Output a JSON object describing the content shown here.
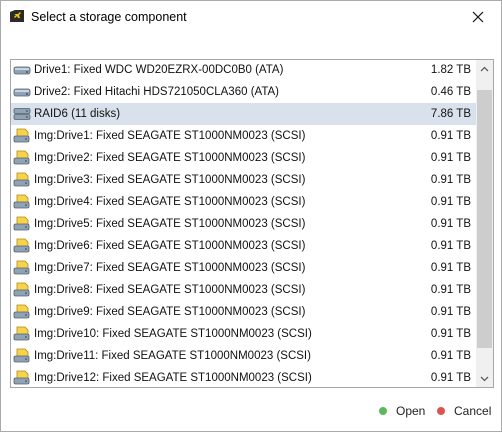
{
  "window": {
    "title": "Select a storage component"
  },
  "list": {
    "rows": [
      {
        "name": "Drive1: Fixed WDC WD20EZRX-00DC0B0 (ATA)",
        "size": "1.82 TB",
        "icon": "hard-drive-icon",
        "selected": false
      },
      {
        "name": "Drive2: Fixed Hitachi HDS721050CLA360 (ATA)",
        "size": "0.46 TB",
        "icon": "hard-drive-icon",
        "selected": false
      },
      {
        "name": "RAID6 (11 disks)",
        "size": "7.86 TB",
        "icon": "raid-icon",
        "selected": true
      },
      {
        "name": "Img:Drive1: Fixed SEAGATE ST1000NM0023 (SCSI)",
        "size": "0.91 TB",
        "icon": "image-drive-icon",
        "selected": false
      },
      {
        "name": "Img:Drive2: Fixed SEAGATE ST1000NM0023 (SCSI)",
        "size": "0.91 TB",
        "icon": "image-drive-icon",
        "selected": false
      },
      {
        "name": "Img:Drive3: Fixed SEAGATE ST1000NM0023 (SCSI)",
        "size": "0.91 TB",
        "icon": "image-drive-icon",
        "selected": false
      },
      {
        "name": "Img:Drive4: Fixed SEAGATE ST1000NM0023 (SCSI)",
        "size": "0.91 TB",
        "icon": "image-drive-icon",
        "selected": false
      },
      {
        "name": "Img:Drive5: Fixed SEAGATE ST1000NM0023 (SCSI)",
        "size": "0.91 TB",
        "icon": "image-drive-icon",
        "selected": false
      },
      {
        "name": "Img:Drive6: Fixed SEAGATE ST1000NM0023 (SCSI)",
        "size": "0.91 TB",
        "icon": "image-drive-icon",
        "selected": false
      },
      {
        "name": "Img:Drive7: Fixed SEAGATE ST1000NM0023 (SCSI)",
        "size": "0.91 TB",
        "icon": "image-drive-icon",
        "selected": false
      },
      {
        "name": "Img:Drive8: Fixed SEAGATE ST1000NM0023 (SCSI)",
        "size": "0.91 TB",
        "icon": "image-drive-icon",
        "selected": false
      },
      {
        "name": "Img:Drive9: Fixed SEAGATE ST1000NM0023 (SCSI)",
        "size": "0.91 TB",
        "icon": "image-drive-icon",
        "selected": false
      },
      {
        "name": "Img:Drive10: Fixed SEAGATE ST1000NM0023 (SCSI)",
        "size": "0.91 TB",
        "icon": "image-drive-icon",
        "selected": false
      },
      {
        "name": "Img:Drive11: Fixed SEAGATE ST1000NM0023 (SCSI)",
        "size": "0.91 TB",
        "icon": "image-drive-icon",
        "selected": false
      },
      {
        "name": "Img:Drive12: Fixed SEAGATE ST1000NM0023 (SCSI)",
        "size": "0.91 TB",
        "icon": "image-drive-icon",
        "selected": false
      }
    ]
  },
  "footer": {
    "open_label": "Open",
    "cancel_label": "Cancel"
  },
  "colors": {
    "open_dot": "#5cb85c",
    "cancel_dot": "#e05252",
    "selected_row": "#d9e2ec"
  }
}
